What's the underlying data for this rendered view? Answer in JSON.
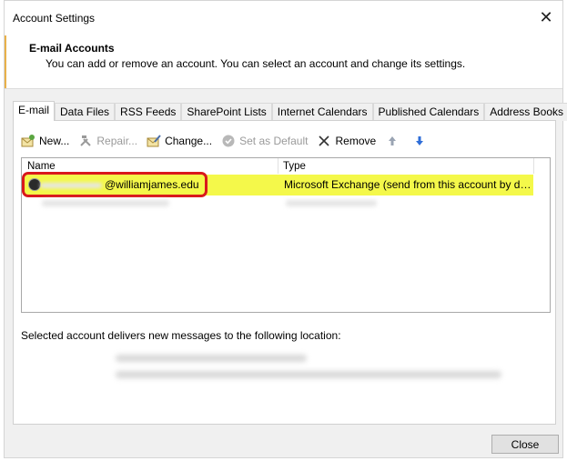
{
  "window": {
    "title": "Account Settings",
    "close_glyph": "✕"
  },
  "header": {
    "title": "E-mail Accounts",
    "description": "You can add or remove an account. You can select an account and change its settings."
  },
  "tabs": [
    {
      "label": "E-mail",
      "active": true
    },
    {
      "label": "Data Files",
      "active": false
    },
    {
      "label": "RSS Feeds",
      "active": false
    },
    {
      "label": "SharePoint Lists",
      "active": false
    },
    {
      "label": "Internet Calendars",
      "active": false
    },
    {
      "label": "Published Calendars",
      "active": false
    },
    {
      "label": "Address Books",
      "active": false
    }
  ],
  "toolbar": {
    "new_label": "New...",
    "repair_label": "Repair...",
    "change_label": "Change...",
    "set_default_label": "Set as Default",
    "remove_label": "Remove"
  },
  "list": {
    "col_name": "Name",
    "col_type": "Type",
    "selected_row": {
      "name": "@williamjames.edu",
      "type": "Microsoft Exchange (send from this account by def..."
    }
  },
  "footer": {
    "deliver_label": "Selected account delivers new messages to the following location:",
    "close_label": "Close"
  },
  "colors": {
    "selection": "#f4f84a",
    "highlight": "#d9191c",
    "arrow_up": "#9aa4b3",
    "arrow_down": "#2f6ed8"
  }
}
